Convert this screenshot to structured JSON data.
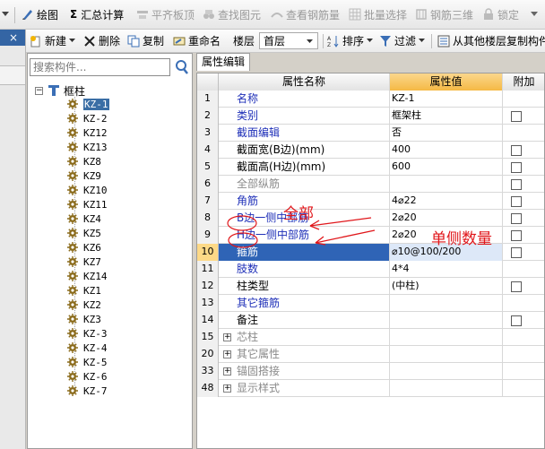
{
  "toolbar1": {
    "items": [
      {
        "label": "绘图",
        "enabled": true
      },
      {
        "label": "汇总计算",
        "enabled": true
      },
      {
        "label": "平齐板顶",
        "enabled": false
      },
      {
        "label": "查找图元",
        "enabled": false
      },
      {
        "label": "查看钢筋量",
        "enabled": false
      },
      {
        "label": "批量选择",
        "enabled": false
      },
      {
        "label": "钢筋三维",
        "enabled": false
      },
      {
        "label": "锁定",
        "enabled": false
      }
    ],
    "sigma": "Σ"
  },
  "toolbar2": {
    "new_label": "新建",
    "delete_label": "删除",
    "copy_label": "复制",
    "rename_label": "重命名",
    "floor_label": "楼层",
    "floor_value": "首层",
    "sort_label": "排序",
    "filter_label": "过滤",
    "copy_from_label": "从其他楼层复制构件"
  },
  "tree": {
    "search_placeholder": "搜索构件...",
    "root_label": "框柱",
    "items": [
      "KZ-1",
      "KZ-2",
      "KZ12",
      "KZ13",
      "KZ8",
      "KZ9",
      "KZ10",
      "KZ11",
      "KZ4",
      "KZ5",
      "KZ6",
      "KZ7",
      "KZ14",
      "KZ1",
      "KZ2",
      "KZ3",
      "KZ-3",
      "KZ-4",
      "KZ-5",
      "KZ-6",
      "KZ-7"
    ],
    "selected": "KZ-1"
  },
  "props": {
    "tab_label": "属性编辑",
    "headers": {
      "name": "属性名称",
      "value": "属性值",
      "extra": "附加"
    },
    "rows": [
      {
        "num": "1",
        "name": "名称",
        "value": "KZ-1",
        "style": "blue",
        "checkbox": false
      },
      {
        "num": "2",
        "name": "类别",
        "value": "框架柱",
        "style": "blue",
        "checkbox": true
      },
      {
        "num": "3",
        "name": "截面编辑",
        "value": "否",
        "style": "blue",
        "checkbox": false
      },
      {
        "num": "4",
        "name": "截面宽(B边)(mm)",
        "value": "400",
        "style": "normal",
        "checkbox": true
      },
      {
        "num": "5",
        "name": "截面高(H边)(mm)",
        "value": "600",
        "style": "normal",
        "checkbox": true
      },
      {
        "num": "6",
        "name": "全部纵筋",
        "value": "",
        "style": "gray",
        "checkbox": true
      },
      {
        "num": "7",
        "name": "角筋",
        "value": "4⌀22",
        "style": "blue",
        "checkbox": true
      },
      {
        "num": "8",
        "name": "B边一侧中部筋",
        "value": "2⌀20",
        "style": "blue",
        "checkbox": true
      },
      {
        "num": "9",
        "name": "H边一侧中部筋",
        "value": "2⌀20",
        "style": "blue",
        "checkbox": true
      },
      {
        "num": "10",
        "name": "箍筋",
        "value": "⌀10@100/200",
        "style": "selected",
        "checkbox": true
      },
      {
        "num": "11",
        "name": "肢数",
        "value": "4*4",
        "style": "blue",
        "checkbox": false
      },
      {
        "num": "12",
        "name": "柱类型",
        "value": "(中柱)",
        "style": "normal",
        "checkbox": true
      },
      {
        "num": "13",
        "name": "其它箍筋",
        "value": "",
        "style": "blue",
        "checkbox": false
      },
      {
        "num": "14",
        "name": "备注",
        "value": "",
        "style": "normal",
        "checkbox": true
      },
      {
        "num": "15",
        "name": "芯柱",
        "value": "",
        "style": "group",
        "checkbox": false
      },
      {
        "num": "20",
        "name": "其它属性",
        "value": "",
        "style": "group",
        "checkbox": false
      },
      {
        "num": "33",
        "name": "锚固搭接",
        "value": "",
        "style": "group",
        "checkbox": false
      },
      {
        "num": "48",
        "name": "显示样式",
        "value": "",
        "style": "group",
        "checkbox": false
      }
    ]
  },
  "annotations": {
    "all": "全部",
    "one_side": "单侧数量"
  },
  "colors": {
    "annotation": "#e0161a",
    "selection": "#2f64b6",
    "header_value": "#f5b945"
  }
}
